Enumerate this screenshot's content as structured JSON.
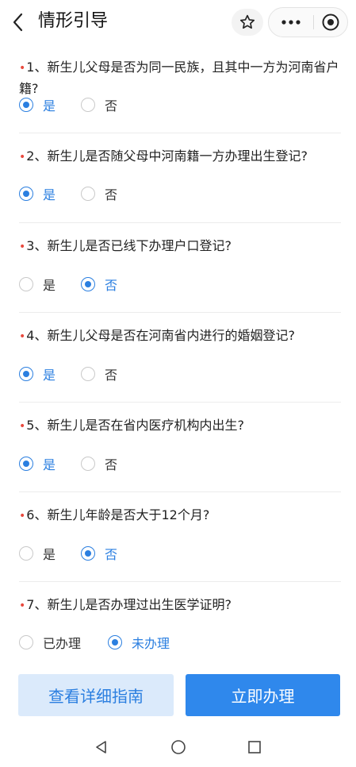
{
  "header": {
    "title": "情形引导"
  },
  "questions": [
    {
      "number": "1、",
      "text": "新生儿父母是否为同一民族，且其中一方为河南省户籍?",
      "options": [
        "是",
        "否"
      ],
      "selected": 0
    },
    {
      "number": "2、",
      "text": "新生儿是否随父母中河南籍一方办理出生登记?",
      "options": [
        "是",
        "否"
      ],
      "selected": 0
    },
    {
      "number": "3、",
      "text": "新生儿是否已线下办理户口登记?",
      "options": [
        "是",
        "否"
      ],
      "selected": 1
    },
    {
      "number": "4、",
      "text": "新生儿父母是否在河南省内进行的婚姻登记?",
      "options": [
        "是",
        "否"
      ],
      "selected": 0
    },
    {
      "number": "5、",
      "text": "新生儿是否在省内医疗机构内出生?",
      "options": [
        "是",
        "否"
      ],
      "selected": 0
    },
    {
      "number": "6、",
      "text": "新生儿年龄是否大于12个月?",
      "options": [
        "是",
        "否"
      ],
      "selected": 1
    },
    {
      "number": "7、",
      "text": "新生儿是否办理过出生医学证明?",
      "options": [
        "已办理",
        "未办理"
      ],
      "selected": 1
    }
  ],
  "required_mark": "•",
  "buttons": {
    "guide_label": "查看详细指南",
    "apply_label": "立即办理"
  },
  "colors": {
    "accent": "#2b7fe0",
    "primary_button": "#2f88ec",
    "secondary_button": "#dbeafb",
    "required": "#e84a3e"
  },
  "icons": {
    "back": "chevron-left-icon",
    "favorite": "star-icon",
    "more": "more-dots-icon",
    "close": "target-icon",
    "nav_back": "triangle-back-icon",
    "nav_home": "circle-home-icon",
    "nav_recent": "square-recent-icon"
  }
}
